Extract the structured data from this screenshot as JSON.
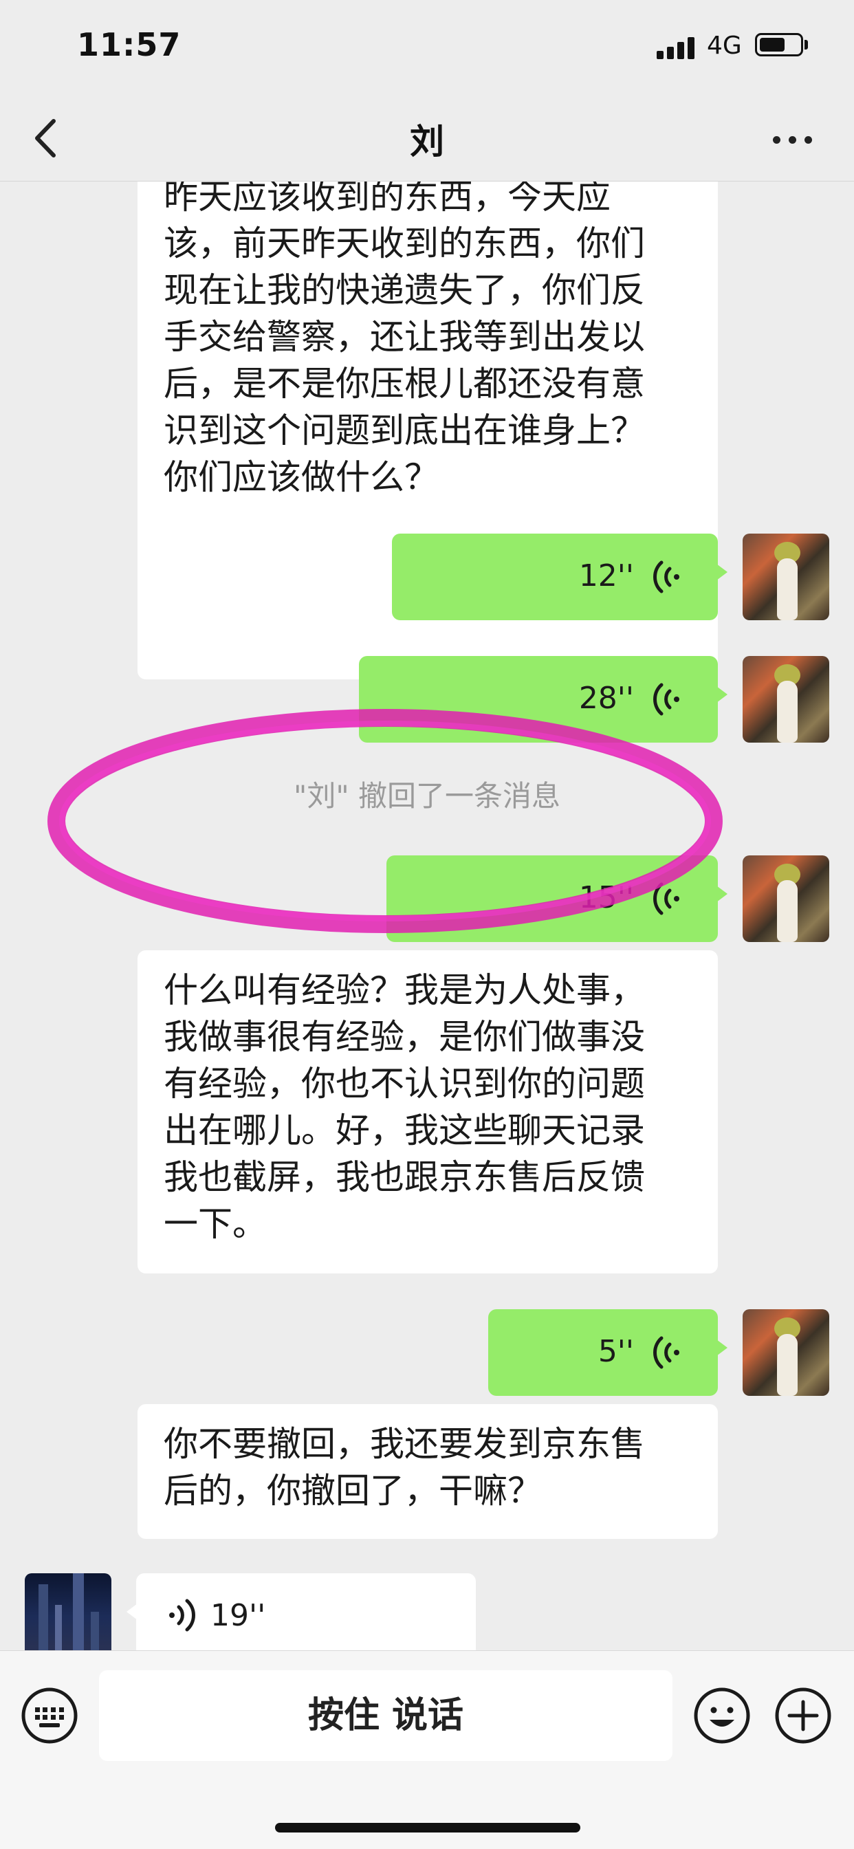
{
  "status_bar": {
    "time": "11:57",
    "network": "4G"
  },
  "nav": {
    "title": "刘"
  },
  "messages": {
    "m1_lines": [
      "昨天应该收到的东西，今天应",
      "该，前天昨天收到的东西，你们",
      "现在让我的快递遗失了，你们反",
      "手交给警察，还让我等到出发以",
      "后，是不是你压根儿都还没有意",
      "识到这个问题到底出在谁身上？",
      "你们应该做什么？"
    ],
    "v1_duration": "12''",
    "v2_duration": "28''",
    "recall_notice": "\"刘\" 撤回了一条消息",
    "v3_duration": "15''",
    "m2_lines": [
      "什么叫有经验？我是为人处事，",
      "我做事很有经验，是你们做事没",
      "有经验，你也不认识到你的问题",
      "出在哪儿。好，我这些聊天记录",
      "我也截屏，我也跟京东售后反馈",
      "一下。"
    ],
    "v4_duration": "5''",
    "m3_lines": [
      "你不要撤回，我还要发到京东售",
      "后的，你撤回了，干嘛？"
    ],
    "v5_duration": "19''"
  },
  "input_bar": {
    "hold_to_talk": "按住 说话"
  },
  "colors": {
    "accent_green": "#95ec69",
    "highlight": "#e020b0"
  }
}
